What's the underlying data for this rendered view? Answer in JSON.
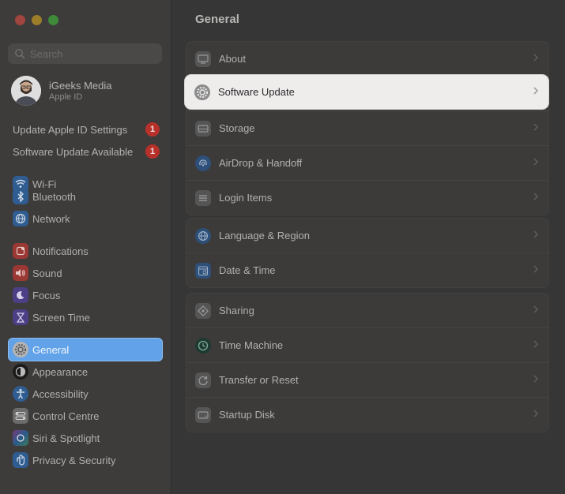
{
  "window": {
    "traffic_lights": [
      "close",
      "minimize",
      "zoom"
    ],
    "colors": {
      "close": "#a0453f",
      "minimize": "#9c7d2a",
      "zoom": "#3e8a39"
    }
  },
  "sidebar": {
    "search_placeholder": "Search",
    "profile": {
      "name": "iGeeks Media",
      "subtitle": "Apple ID"
    },
    "alerts": [
      {
        "label": "Update Apple ID Settings",
        "badge": "1"
      },
      {
        "label": "Software Update Available",
        "badge": "1"
      }
    ],
    "items": [
      {
        "label": "Wi-Fi",
        "icon": "wifi-icon"
      },
      {
        "label": "Bluetooth",
        "icon": "bluetooth-icon"
      },
      {
        "label": "Network",
        "icon": "network-icon"
      },
      {
        "label": "Notifications",
        "icon": "notifications-icon"
      },
      {
        "label": "Sound",
        "icon": "sound-icon"
      },
      {
        "label": "Focus",
        "icon": "focus-icon"
      },
      {
        "label": "Screen Time",
        "icon": "screen-time-icon"
      },
      {
        "label": "General",
        "icon": "general-icon",
        "selected": true
      },
      {
        "label": "Appearance",
        "icon": "appearance-icon"
      },
      {
        "label": "Accessibility",
        "icon": "accessibility-icon"
      },
      {
        "label": "Control Centre",
        "icon": "control-centre-icon"
      },
      {
        "label": "Siri & Spotlight",
        "icon": "siri-icon"
      },
      {
        "label": "Privacy & Security",
        "icon": "privacy-icon"
      }
    ]
  },
  "main": {
    "title": "General",
    "groups": [
      [
        {
          "label": "About",
          "icon": "about-icon"
        },
        {
          "label": "Software Update",
          "icon": "software-update-icon",
          "highlighted": true
        },
        {
          "label": "Storage",
          "icon": "storage-icon"
        },
        {
          "label": "AirDrop & Handoff",
          "icon": "airdrop-icon"
        },
        {
          "label": "Login Items",
          "icon": "login-items-icon"
        }
      ],
      [
        {
          "label": "Language & Region",
          "icon": "globe-icon"
        },
        {
          "label": "Date & Time",
          "icon": "calendar-icon"
        }
      ],
      [
        {
          "label": "Sharing",
          "icon": "sharing-icon"
        },
        {
          "label": "Time Machine",
          "icon": "time-machine-icon"
        },
        {
          "label": "Transfer or Reset",
          "icon": "transfer-reset-icon"
        },
        {
          "label": "Startup Disk",
          "icon": "startup-disk-icon"
        }
      ]
    ]
  },
  "colors": {
    "accent": "#62a2e8",
    "badge": "#b7302a",
    "highlight_row": "#efecec"
  }
}
